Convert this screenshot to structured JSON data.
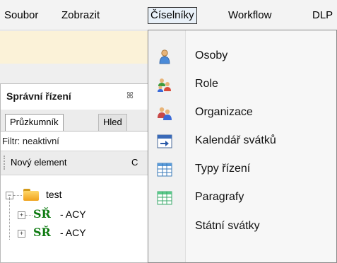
{
  "menubar": {
    "items": [
      "Soubor",
      "Zobrazit",
      "Číselníky",
      "Workflow",
      "DLP"
    ]
  },
  "panel": {
    "title": "Správní řízení",
    "close_label": "ꕤ",
    "tabs": [
      "Průzkumník",
      "Hled"
    ],
    "filter": "Filtr: neaktivní",
    "actions": {
      "new_element": "Nový element",
      "next": "C"
    },
    "tree": [
      {
        "label": "test",
        "expander": "−"
      },
      {
        "code": "SŘ",
        "label": "- ACY",
        "expander": "+"
      },
      {
        "code": "SŘ",
        "label": "- ACY",
        "expander": "+"
      }
    ]
  },
  "dropdown": {
    "items": [
      {
        "label": "Osoby",
        "icon": "person-icon"
      },
      {
        "label": "Role",
        "icon": "users-role-icon"
      },
      {
        "label": "Organizace",
        "icon": "organization-icon"
      },
      {
        "label": "Kalendář svátků",
        "icon": "calendar-icon"
      },
      {
        "label": "Typy řízení",
        "icon": "table-icon"
      },
      {
        "label": "Paragrafy",
        "icon": "table-icon"
      },
      {
        "label": "Státní svátky",
        "icon": ""
      }
    ]
  },
  "colors": {
    "toolbar": "#fbf2d8",
    "sr_code": "#0d7a10",
    "folder": "#f0a21c"
  }
}
